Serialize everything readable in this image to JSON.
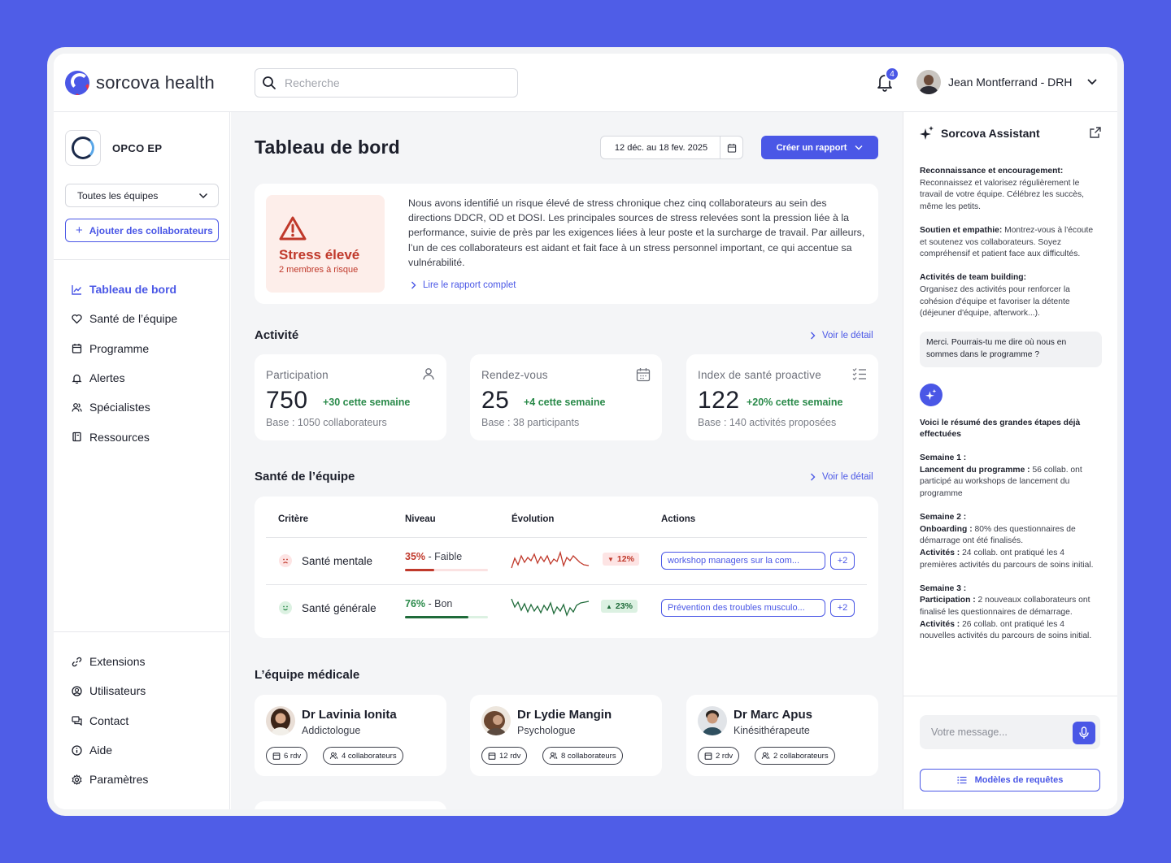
{
  "brand": {
    "name": "sorcova health",
    "accent": "#4a57e6",
    "danger": "#c0392b",
    "success": "#2a8a4a"
  },
  "header": {
    "search_placeholder": "Recherche",
    "notifications_count": "4",
    "user_name": "Jean Montferrand - DRH"
  },
  "sidebar": {
    "org_name": "OPCO EP",
    "team_select": "Toutes les équipes",
    "add_button": "Ajouter des collaborateurs",
    "nav": [
      {
        "label": "Tableau de bord",
        "icon": "chart-icon"
      },
      {
        "label": "Santé de l’équipe",
        "icon": "heart-icon"
      },
      {
        "label": "Programme",
        "icon": "calendar-icon"
      },
      {
        "label": "Alertes",
        "icon": "bell-icon"
      },
      {
        "label": "Spécialistes",
        "icon": "people-icon"
      },
      {
        "label": "Ressources",
        "icon": "book-icon"
      }
    ],
    "bottom_nav": [
      {
        "label": "Extensions",
        "icon": "link-icon"
      },
      {
        "label": "Utilisateurs",
        "icon": "user-circle-icon"
      },
      {
        "label": "Contact",
        "icon": "chat-icon"
      },
      {
        "label": "Aide",
        "icon": "info-icon"
      },
      {
        "label": "Paramètres",
        "icon": "gear-icon"
      }
    ]
  },
  "main": {
    "title": "Tableau de bord",
    "date_range": "12 déc. au 18 fev. 2025",
    "create_report": "Créer un rapport",
    "alert": {
      "title": "Stress élevé",
      "subtitle": "2 membres à risque",
      "text": "Nous avons identifié un risque élevé de stress chronique chez cinq collaborateurs au sein des directions DDCR, OD et DOSI. Les principales sources de stress relevées sont la pression liée à la performance, suivie de près par les exigences liées à leur poste et la surcharge de travail. Par ailleurs, l’un de ces collaborateurs est aidant et fait face à un stress personnel important, ce qui accentue sa vulnérabilité.",
      "link": "Lire le rapport complet"
    },
    "activity": {
      "title": "Activité",
      "detail_link": "Voir le détail",
      "kpis": [
        {
          "label": "Participation",
          "value": "750",
          "delta": "+30 cette semaine",
          "base": "Base : 1050 collaborateurs",
          "icon": "user-icon"
        },
        {
          "label": "Rendez-vous",
          "value": "25",
          "delta": "+4 cette semaine",
          "base": "Base : 38 participants",
          "icon": "calendar-icon"
        },
        {
          "label": "Index de santé proactive",
          "value": "122",
          "delta": "+20% cette semaine",
          "base": "Base : 140 activités proposées",
          "icon": "checklist-icon"
        }
      ]
    },
    "health": {
      "title": "Santé de l’équipe",
      "detail_link": "Voir le détail",
      "columns": [
        "Critère",
        "Niveau",
        "Évolution",
        "Actions"
      ],
      "rows": [
        {
          "name": "Santé mentale",
          "level_pct": "35%",
          "level_label": " - Faible",
          "level_value": 0.35,
          "trend": "12%",
          "trend_dir": "down",
          "action": "workshop managers sur la com...",
          "more": "+2"
        },
        {
          "name": "Santé générale",
          "level_pct": "76%",
          "level_label": " - Bon",
          "level_value": 0.76,
          "trend": "23%",
          "trend_dir": "up",
          "action": "Prévention des troubles musculo...",
          "more": "+2"
        }
      ]
    },
    "medical": {
      "title": "L’équipe médicale",
      "doctors": [
        {
          "name": "Dr Lavinia Ionita",
          "role": "Addictologue",
          "rdv": "6 rdv",
          "collab": "4 collaborateurs"
        },
        {
          "name": "Dr Lydie Mangin",
          "role": "Psychologue",
          "rdv": "12 rdv",
          "collab": "8 collaborateurs"
        },
        {
          "name": "Dr Marc Apus",
          "role": "Kinésithérapeute",
          "rdv": "2 rdv",
          "collab": "2 collaborateurs"
        }
      ]
    }
  },
  "assistant": {
    "title": "Sorcova Assistant",
    "msg1_title": "Reconnaissance et encouragement:",
    "msg1_text": "Reconnaissez et valorisez régulièrement le travail de votre équipe. Célébrez les succès, même les petits.",
    "msg2_title": "Soutien et empathie:",
    "msg2_text": " Montrez-vous à l'écoute et soutenez vos collaborateurs. Soyez compréhensif et patient face aux difficultés.",
    "msg3_title": "Activités de team building:",
    "msg3_text": "Organisez des activités pour renforcer la cohésion d'équipe et favoriser la détente (déjeuner d'équipe, afterwork...).",
    "user_msg": "Merci. Pourrais-tu me dire où nous en sommes dans le programme ?",
    "reply_title": "Voici le résumé des grandes étapes déjà effectuées",
    "w1": "Semaine 1 :",
    "w1_a_title": "Lancement du programme :",
    "w1_a_text": " 56 collab. ont participé au workshops de lancement du programme",
    "w2": "Semaine 2 :",
    "w2_a_title": "Onboarding :",
    "w2_a_text": " 80% des questionnaires de démarrage ont été finalisés.",
    "w2_b_title": "Activités :",
    "w2_b_text": " 24 collab. ont pratiqué les 4 premières activités du parcours de soins initial.",
    "w3": "Semaine 3 :",
    "w3_a_title": "Participation :",
    "w3_a_text": " 2 nouveaux collaborateurs ont finalisé les questionnaires de démarrage.",
    "w3_b_title": "Activités :",
    "w3_b_text": " 26 collab. ont pratiqué les 4 nouvelles activités du parcours de soins initial.",
    "input_placeholder": "Votre message...",
    "templates_button": "Modèles de requêtes"
  }
}
